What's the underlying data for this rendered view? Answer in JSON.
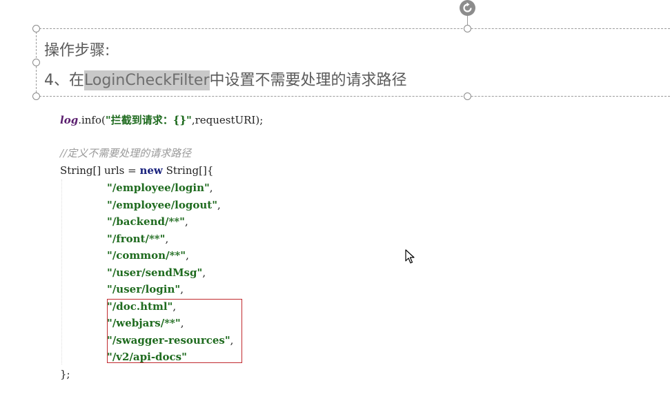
{
  "slide": {
    "heading_steps": "操作步骤:",
    "heading_item_prefix": "4、在",
    "heading_item_highlight": "LoginCheckFilter",
    "heading_item_suffix": "中设置不需要处理的请求路径"
  },
  "code": {
    "log_line": {
      "object": "log",
      "method": ".info(",
      "string": "\"拦截到请求：{}\"",
      "rest": ",requestURI);"
    },
    "comment": "//定义不需要处理的请求路径",
    "decl": {
      "before": "String[] urls = ",
      "keyword": "new",
      "after": " String[]{"
    },
    "urls": [
      "\"/employee/login\"",
      "\"/employee/logout\"",
      "\"/backend/**\"",
      "\"/front/**\"",
      "\"/common/**\"",
      "\"/user/sendMsg\"",
      "\"/user/login\"",
      "\"/doc.html\"",
      "\"/webjars/**\"",
      "\"/swagger-resources\"",
      "\"/v2/api-docs\""
    ],
    "url_separators": [
      ",",
      ",",
      ",",
      ",",
      ",",
      ",",
      ",",
      ",",
      ",",
      ",",
      ""
    ],
    "closing": "};"
  },
  "colors": {
    "highlight_box": "#c0282d",
    "string": "#1f6b1f",
    "keyword": "#1a237e",
    "comment": "#9a9a9a"
  }
}
